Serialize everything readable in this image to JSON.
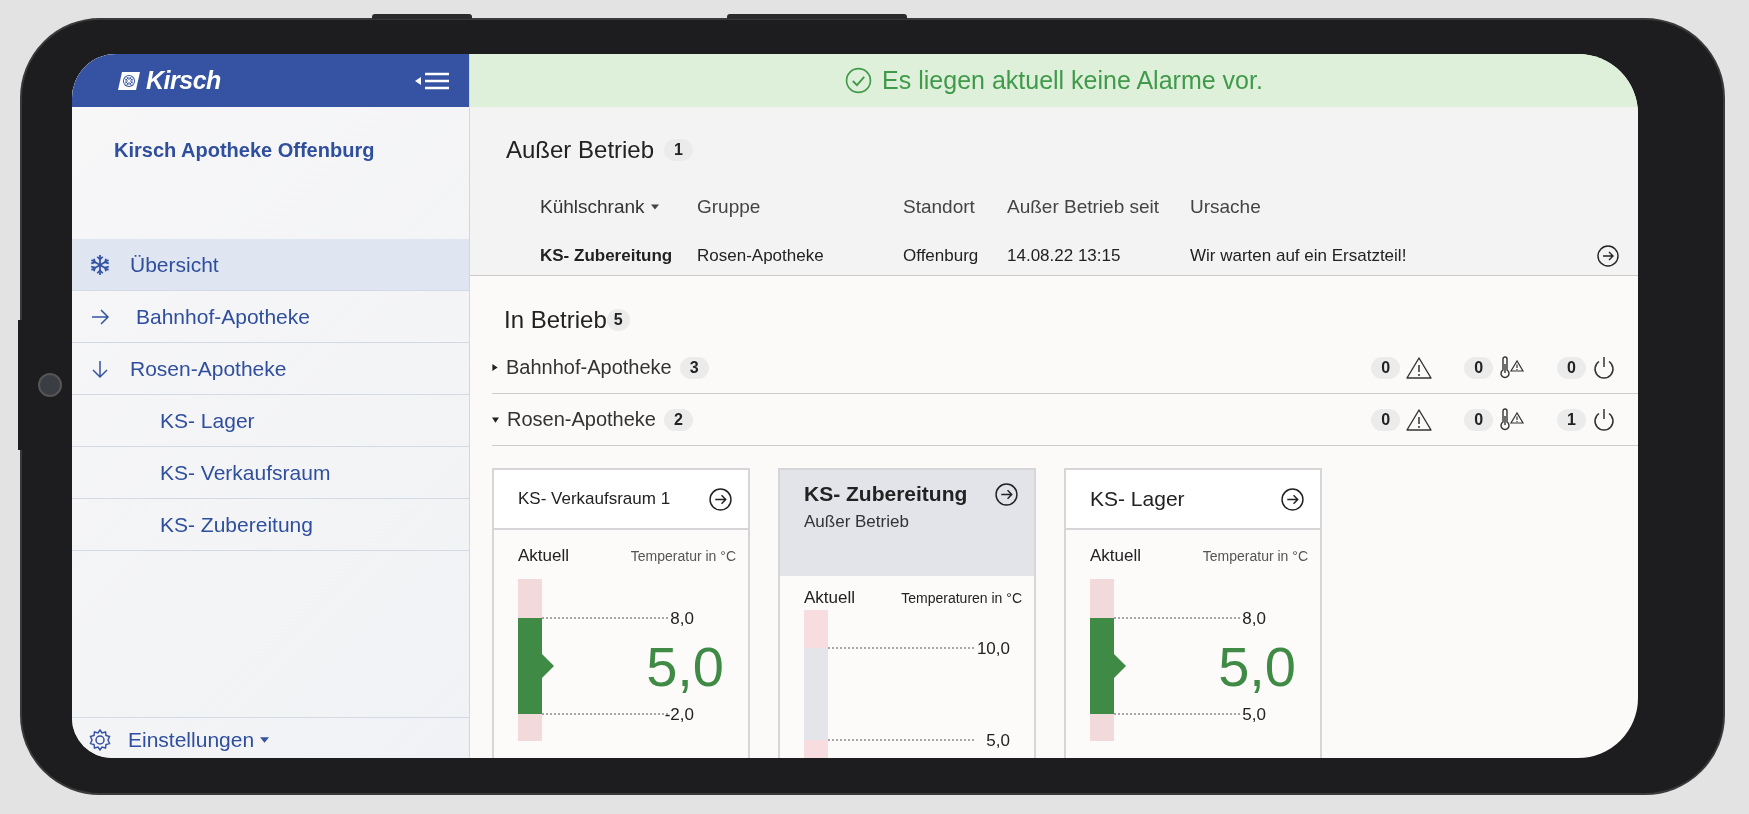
{
  "sidebar": {
    "logo": "Kirsch",
    "title": "Kirsch Apotheke Offenburg",
    "items": [
      {
        "label": "Übersicht",
        "kind": "overview",
        "selected": true
      },
      {
        "label": "Bahnhof-Apotheke",
        "kind": "group",
        "expanded": false,
        "selected": false
      },
      {
        "label": "Rosen-Apotheke",
        "kind": "group",
        "expanded": true,
        "selected": false,
        "children": [
          {
            "label": "KS- Lager",
            "selected": false
          },
          {
            "label": "KS- Verkaufsraum",
            "selected": false
          },
          {
            "label": "KS- Zubereitung",
            "selected": false
          }
        ]
      }
    ],
    "footer": "Einstellungen"
  },
  "alarm_banner": "Es liegen aktuell keine Alarme vor.",
  "out_of_service": {
    "title": "Außer Betrieb",
    "count": "1",
    "columns": [
      {
        "label": "Kühlschrank",
        "sorted": true
      },
      {
        "label": "Gruppe",
        "sorted": false
      },
      {
        "label": "Standort",
        "sorted": false
      },
      {
        "label": "Außer Betrieb seit",
        "sorted": false
      },
      {
        "label": "Ursache",
        "sorted": false
      }
    ],
    "rows": [
      [
        "KS- Zubereitung",
        "Rosen-Apotheke",
        "Offenburg",
        "14.08.22  13:15",
        "Wir warten auf ein Ersatzteil!"
      ]
    ]
  },
  "in_service": {
    "title": "In Betrieb",
    "count": "5",
    "groups": [
      {
        "name": "Bahnhof-Apotheke",
        "count": "3",
        "expanded": false,
        "alarms": "0",
        "temperature_alarms": "0",
        "out_of_service": "0"
      },
      {
        "name": "Rosen-Apotheke",
        "count": "2",
        "expanded": true,
        "alarms": "0",
        "temperature_alarms": "0",
        "out_of_service": "1",
        "devices": [
          {
            "kind": "active",
            "name": "KS- Verkaufsraum 1",
            "current_label": "Aktuell",
            "unit_label": "Temperatur in °C",
            "upper": "8,0",
            "lower": "-2,0",
            "value": "5,0"
          },
          {
            "kind": "out_of_service",
            "name": "KS- Zubereitung",
            "status": "Außer Betrieb",
            "current_label": "Aktuell",
            "unit_label": "Temperaturen in °C",
            "upper": "10,0",
            "lower": "5,0"
          },
          {
            "kind": "active",
            "name": "KS- Lager",
            "current_label": "Aktuell",
            "unit_label": "Temperatur in °C",
            "upper": "8,0",
            "lower": "5,0",
            "value": "5,0"
          }
        ]
      }
    ]
  }
}
